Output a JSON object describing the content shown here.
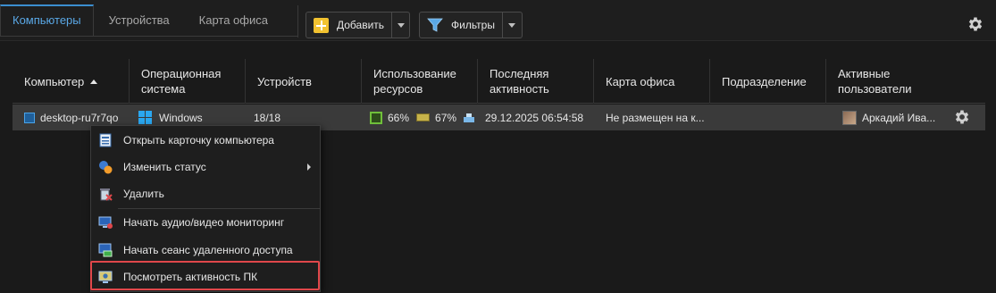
{
  "tabs": [
    {
      "label": "Компьютеры",
      "active": true
    },
    {
      "label": "Устройства",
      "active": false
    },
    {
      "label": "Карта офиса",
      "active": false
    }
  ],
  "toolbar": {
    "add_label": "Добавить",
    "filters_label": "Фильтры",
    "add_icon": "plus-icon",
    "filters_icon": "filter-funnel-icon"
  },
  "table": {
    "columns": [
      {
        "label": "Компьютер",
        "sorted": "ascending"
      },
      {
        "label": "Операционная система"
      },
      {
        "label": "Устройств"
      },
      {
        "label": "Использование ресурсов"
      },
      {
        "label": "Последняя активность"
      },
      {
        "label": "Карта офиса"
      },
      {
        "label": "Подразделение"
      },
      {
        "label": "Активные пользователи"
      }
    ],
    "rows": [
      {
        "computer": "desktop-ru7r7qo",
        "os": "Windows",
        "devices": "18/18",
        "cpu": "66%",
        "ram": "67%",
        "last_activity": "29.12.2025 06:54:58",
        "office_map": "Не размещен на к...",
        "department": "",
        "active_users": "Аркадий Ива..."
      }
    ]
  },
  "context_menu": {
    "items": [
      {
        "label": "Открыть карточку компьютера",
        "icon": "computer-card-icon"
      },
      {
        "label": "Изменить статус",
        "icon": "status-change-icon",
        "submenu": true
      },
      {
        "label": "Удалить",
        "icon": "delete-icon"
      },
      {
        "label": "Начать аудио/видео мониторинг",
        "icon": "av-monitoring-icon"
      },
      {
        "label": "Начать сеанс удаленного доступа",
        "icon": "remote-access-icon"
      },
      {
        "label": "Посмотреть активность ПК",
        "icon": "pc-activity-icon",
        "highlighted": true
      }
    ]
  },
  "colors": {
    "accent": "#3b8ed0",
    "highlight": "#e0474a",
    "row_selected": "#3a3a3a"
  }
}
